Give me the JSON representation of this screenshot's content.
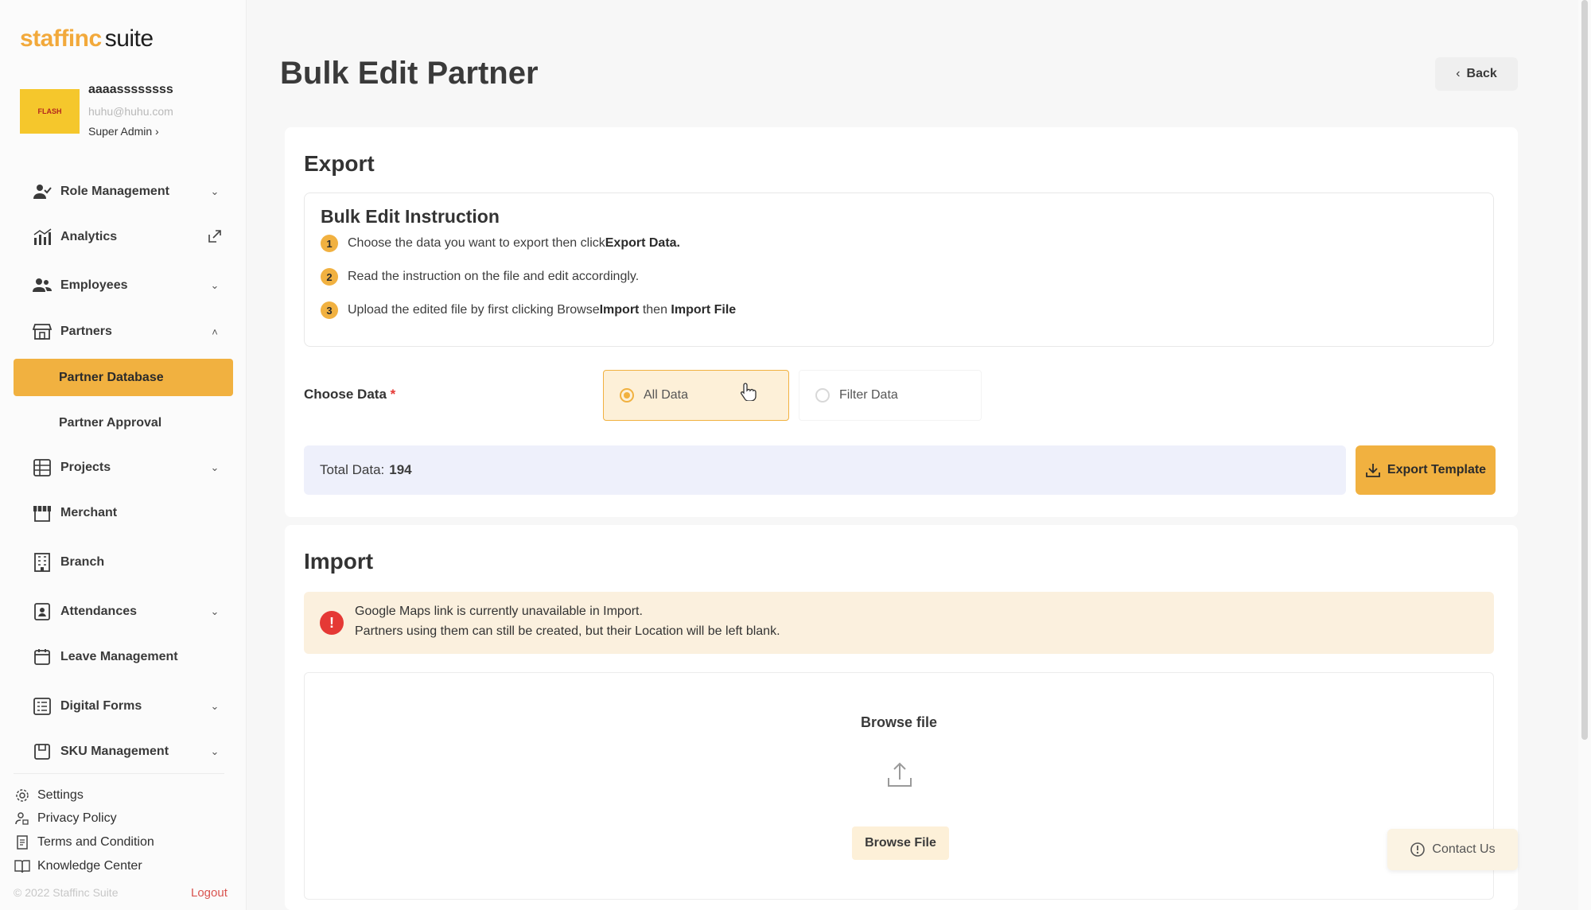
{
  "sidebar": {
    "logo_brand": "staffinc",
    "logo_suite": "suite",
    "profile": {
      "avatar_text": "FLASH",
      "name": "aaaassssssss",
      "email": "huhu@huhu.com",
      "role": "Super Admin ›"
    },
    "nav": {
      "role_management": "Role Management",
      "analytics": "Analytics",
      "employees": "Employees",
      "partners": "Partners",
      "partner_database": "Partner Database",
      "partner_approval": "Partner Approval",
      "projects": "Projects",
      "merchant": "Merchant",
      "branch": "Branch",
      "attendances": "Attendances",
      "leave_management": "Leave Management",
      "digital_forms": "Digital Forms",
      "sku_management": "SKU Management"
    },
    "footer": {
      "settings": "Settings",
      "privacy_policy": "Privacy Policy",
      "terms": "Terms and Condition",
      "knowledge_center": "Knowledge Center",
      "copyright": "© 2022 Staffinc Suite",
      "logout": "Logout"
    }
  },
  "header": {
    "title": "Bulk Edit Partner",
    "back_label": "Back"
  },
  "export": {
    "title": "Export",
    "instruction_title": "Bulk Edit Instruction",
    "steps": [
      {
        "num": "1",
        "pre": "Choose the data you want to export then click ",
        "b1": "Export Data.",
        "mid": "",
        "b2": ""
      },
      {
        "num": "2",
        "pre": "Read the instruction on the file and edit accordingly.",
        "b1": "",
        "mid": "",
        "b2": ""
      },
      {
        "num": "3",
        "pre": "Upload the edited file by first clicking Browse ",
        "b1": "Import",
        "mid": " then ",
        "b2": "Import File"
      }
    ],
    "choose_label": "Choose Data",
    "required_mark": "*",
    "options": {
      "all": "All Data",
      "filter": "Filter Data"
    },
    "selected_option": "All Data",
    "total_label": "Total Data:",
    "total_value": "194",
    "export_button": "Export Template"
  },
  "import": {
    "title": "Import",
    "warning_line1": "Google Maps link is currently unavailable in Import.",
    "warning_line2": "Partners using them can still be created, but their Location will be left blank.",
    "browse_title": "Browse file",
    "browse_button": "Browse File"
  },
  "contact_label": "Contact Us",
  "colors": {
    "accent": "#f1b140",
    "accent_light": "#fdf0d8",
    "warning_bg": "#fbf0de",
    "error": "#e53935",
    "total_bg": "#eef0fb"
  }
}
